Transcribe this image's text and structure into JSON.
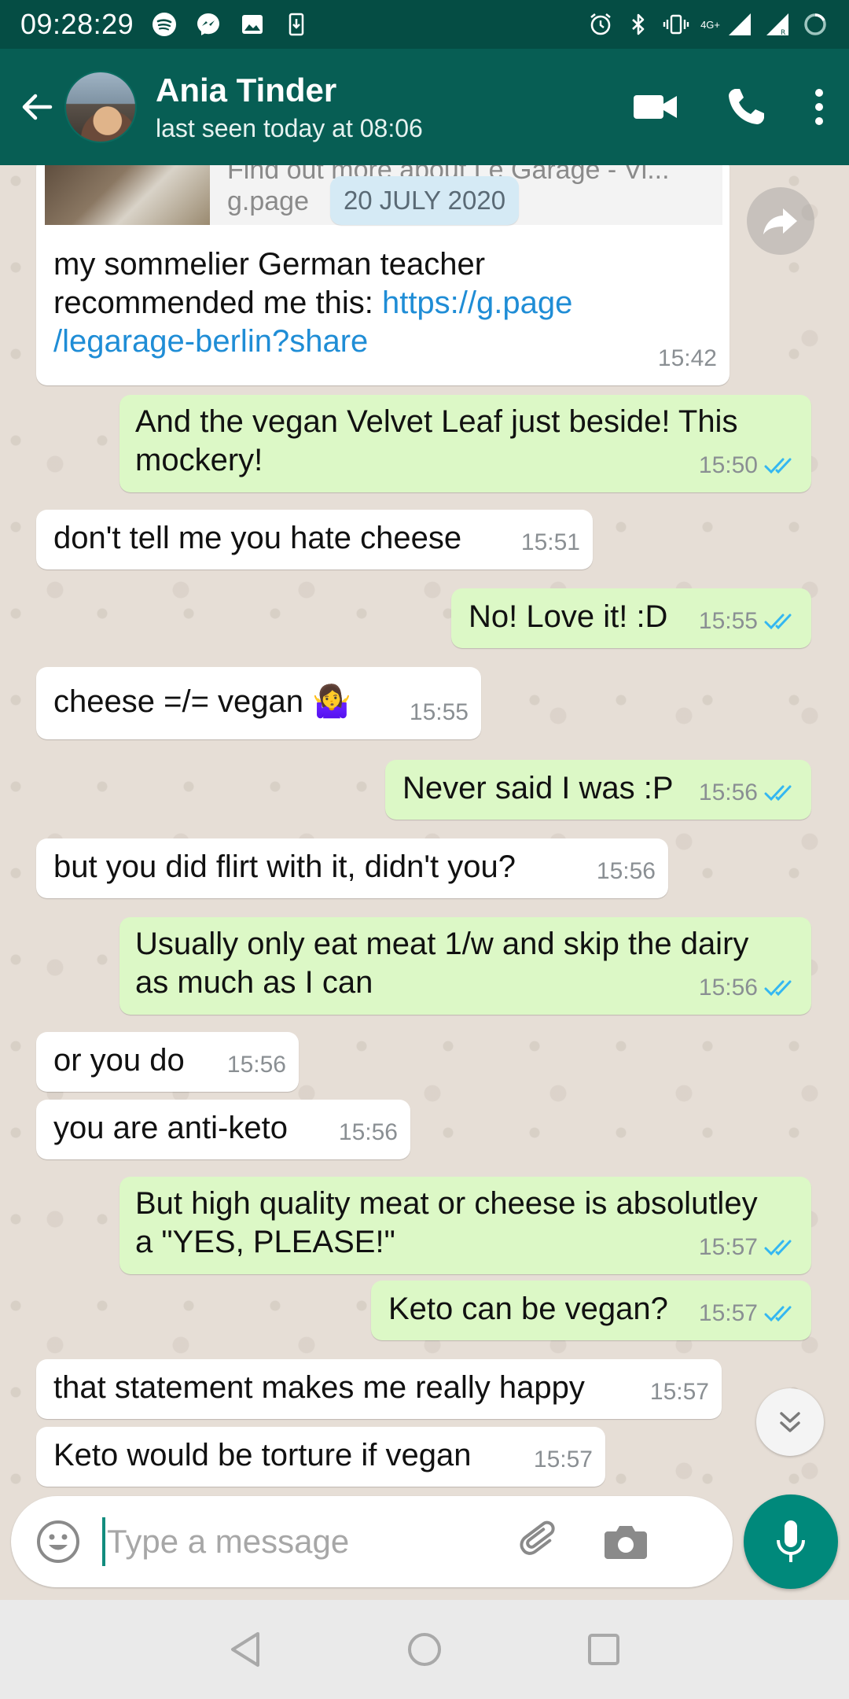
{
  "status_bar": {
    "time": "09:28:29",
    "network_label": "4G+",
    "icons_left": [
      "spotify-icon",
      "messenger-icon",
      "gallery-icon",
      "download-icon"
    ],
    "icons_right": [
      "alarm-icon",
      "bluetooth-icon",
      "vibrate-icon",
      "signal-icon",
      "battery-icon"
    ]
  },
  "header": {
    "contact_name": "Ania Tinder",
    "last_seen": "last seen today at 08:06",
    "actions": [
      "video-call-icon",
      "voice-call-icon",
      "more-options-icon"
    ]
  },
  "chat": {
    "link_preview": {
      "title": "Find out more about Le Garage - Vi...",
      "domain": "g.page"
    },
    "date_chip": "20 JULY 2020",
    "messages": [
      {
        "dir": "in",
        "text": "my sommelier German teacher recommended me this: ",
        "link": "https://g.page /legarage-berlin?share",
        "time": "15:42"
      },
      {
        "dir": "out",
        "text": "And the vegan Velvet Leaf just beside! This mockery!",
        "time": "15:50",
        "status": "read"
      },
      {
        "dir": "in",
        "text": "don't tell me you hate cheese",
        "time": "15:51"
      },
      {
        "dir": "out",
        "text": "No! Love it! :D",
        "time": "15:55",
        "status": "read"
      },
      {
        "dir": "in",
        "text": "cheese =/= vegan 🤷‍♀️",
        "time": "15:55"
      },
      {
        "dir": "out",
        "text": "Never said I was :P",
        "time": "15:56",
        "status": "read"
      },
      {
        "dir": "in",
        "text": "but you did flirt with it, didn't you?",
        "time": "15:56"
      },
      {
        "dir": "out",
        "text": "Usually only eat meat 1/w and skip the dairy as much as I can",
        "time": "15:56",
        "status": "read"
      },
      {
        "dir": "in",
        "text": "or you do",
        "time": "15:56"
      },
      {
        "dir": "in",
        "text": "you are anti-keto",
        "time": "15:56"
      },
      {
        "dir": "out",
        "text": "But high quality meat or cheese is absolutley a \"YES, PLEASE!\"",
        "time": "15:57",
        "status": "read"
      },
      {
        "dir": "out",
        "text": "Keto can be vegan?",
        "time": "15:57",
        "status": "read"
      },
      {
        "dir": "in",
        "text": "that statement makes me really happy",
        "time": "15:57"
      },
      {
        "dir": "in",
        "text": "Keto would be torture if vegan",
        "time": "15:57"
      }
    ]
  },
  "composer": {
    "placeholder": "Type a message"
  },
  "colors": {
    "header": "#075e54",
    "status_bar": "#054d44",
    "outgoing_bubble": "#dcf8c6",
    "incoming_bubble": "#ffffff",
    "read_ticks": "#34b7f1",
    "mic_button": "#00897b"
  }
}
